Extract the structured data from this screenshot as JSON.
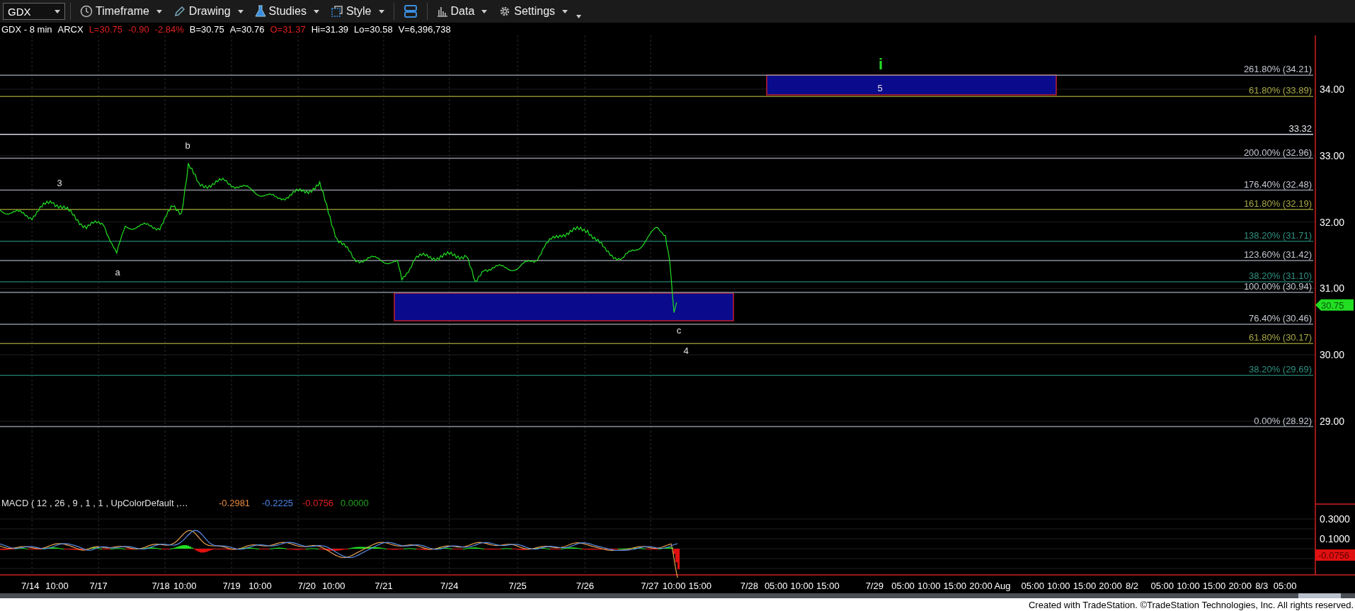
{
  "toolbar": {
    "symbol": "GDX",
    "items": [
      {
        "kind": "clock",
        "label": "Timeframe",
        "dropdown": true
      },
      {
        "kind": "pencil",
        "label": "Drawing",
        "dropdown": true
      },
      {
        "kind": "flask",
        "label": "Studies",
        "dropdown": true
      },
      {
        "kind": "square",
        "label": "Style",
        "dropdown": true
      },
      {
        "kind": "layout",
        "dropdown": false
      },
      {
        "kind": "bars",
        "label": "Data",
        "dropdown": true
      },
      {
        "kind": "gear",
        "label": "Settings",
        "dropdown": true
      }
    ]
  },
  "quote": [
    {
      "text": "GDX - 8 min",
      "color": "#ffffff"
    },
    {
      "text": "ARCX",
      "color": "#ffffff"
    },
    {
      "text": "L=30.75",
      "color": "#e02020"
    },
    {
      "text": "-0.90",
      "color": "#e02020"
    },
    {
      "text": "-2.84%",
      "color": "#e02020"
    },
    {
      "text": "B=30.75",
      "color": "#ffffff"
    },
    {
      "text": "A=30.76",
      "color": "#ffffff"
    },
    {
      "text": "O=31.37",
      "color": "#e02020"
    },
    {
      "text": "Hi=31.39",
      "color": "#ffffff"
    },
    {
      "text": "Lo=30.58",
      "color": "#ffffff"
    },
    {
      "text": "V=6,396,738",
      "color": "#ffffff"
    }
  ],
  "fib_lines": [
    {
      "label": "261.80% (34.21)",
      "kind": "gray"
    },
    {
      "label": "61.80% (33.89)",
      "kind": "olive"
    },
    {
      "label": "33.32",
      "kind": "white"
    },
    {
      "label": "200.00% (32.96)",
      "kind": "gray"
    },
    {
      "label": "176.40% (32.48)",
      "kind": "gray"
    },
    {
      "label": "161.80% (32.19)",
      "kind": "olive"
    },
    {
      "label": "138.20% (31.71)",
      "kind": "teal"
    },
    {
      "label": "123.60% (31.42)",
      "kind": "gray"
    },
    {
      "label": "38.20% (31.10)",
      "kind": "teal"
    },
    {
      "label": "100.00% (30.94)",
      "kind": "gray"
    },
    {
      "label": "76.40% (30.46)",
      "kind": "gray"
    },
    {
      "label": "61.80% (30.17)",
      "kind": "olive"
    },
    {
      "label": "38.20% (29.69)",
      "kind": "teal"
    },
    {
      "label": "0.00% (28.92)",
      "kind": "gray"
    }
  ],
  "wave_labels": [
    {
      "text": "i",
      "kind": "major"
    },
    {
      "text": "5",
      "kind": "minor"
    },
    {
      "text": "3",
      "kind": "minor"
    },
    {
      "text": "b",
      "kind": "minor"
    },
    {
      "text": "a",
      "kind": "minor"
    },
    {
      "text": "c",
      "kind": "minor"
    },
    {
      "text": "4",
      "kind": "minor"
    }
  ],
  "price_axis": [
    "34.00",
    "33.00",
    "32.00",
    "31.00",
    "30.00",
    "29.00"
  ],
  "last_price": "30.75",
  "macd": {
    "label": "MACD ( 12 , 26 , 9 , 1 , 1 , UpColorDefault ,…",
    "values": [
      {
        "text": "-0.2981",
        "color": "#e8883a"
      },
      {
        "text": "-0.2225",
        "color": "#4a86e8"
      },
      {
        "text": "-0.0756",
        "color": "#e02020"
      },
      {
        "text": "0.0000",
        "color": "#20a020"
      }
    ],
    "axis": [
      "0.3000",
      "0.1000"
    ],
    "last_value": "-0.0756"
  },
  "time_axis": [
    "7/14",
    "10:00",
    "7/17",
    "7/18",
    "10:00",
    "7/19",
    "10:00",
    "7/20",
    "10:00",
    "7/21",
    "7/24",
    "7/25",
    "7/26",
    "7/27",
    "10:00",
    "15:00",
    "7/28",
    "05:00",
    "10:00",
    "15:00",
    "7/29",
    "05:00",
    "10:00",
    "15:00",
    "20:00",
    "Aug",
    "05:00",
    "10:00",
    "15:00",
    "20:00",
    "8/2",
    "05:00",
    "10:00",
    "15:00",
    "20:00",
    "8/3",
    "05:00"
  ],
  "footer": "Created with TradeStation. ©TradeStation Technologies, Inc. All rights reserved."
}
